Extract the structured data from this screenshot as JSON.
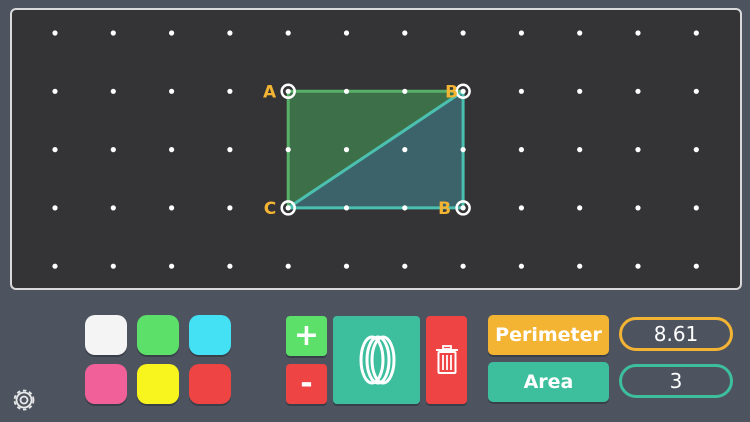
{
  "board": {
    "grid": {
      "cols": 12,
      "rows": 5
    },
    "vertices": [
      {
        "id": "A-top",
        "label": "A",
        "col": 4,
        "row": 1,
        "label_side": "left"
      },
      {
        "id": "B-top",
        "label": "B",
        "col": 7,
        "row": 1,
        "label_side": "left-overlap"
      },
      {
        "id": "C",
        "label": "C",
        "col": 4,
        "row": 3,
        "label_side": "left"
      },
      {
        "id": "B-bottom",
        "label": "B",
        "col": 7,
        "row": 3,
        "label_side": "left"
      }
    ],
    "shapes": [
      {
        "name": "green-triangle",
        "fill": "#3f7a4c",
        "stroke": "#58b068",
        "points": [
          [
            4,
            1
          ],
          [
            7,
            1
          ],
          [
            4,
            3
          ]
        ]
      },
      {
        "name": "teal-triangle",
        "fill": "#3d6c72",
        "stroke": "#4bc0b0",
        "points": [
          [
            7,
            1
          ],
          [
            7,
            3
          ],
          [
            4,
            3
          ]
        ]
      }
    ],
    "label_color": "#f4b433"
  },
  "colors": [
    {
      "name": "white",
      "hex": "#f4f4f4"
    },
    {
      "name": "green",
      "hex": "#5ce06a"
    },
    {
      "name": "cyan",
      "hex": "#44e0f4"
    },
    {
      "name": "pink",
      "hex": "#f2609a"
    },
    {
      "name": "yellow",
      "hex": "#f8f41e"
    },
    {
      "name": "red",
      "hex": "#ee4444"
    }
  ],
  "controls": {
    "plus_label": "+",
    "minus_label": "-",
    "rubber_band_icon": "rubber-band-icon",
    "delete_icon": "trash-icon"
  },
  "measures": {
    "perimeter_label": "Perimeter",
    "perimeter_value": "8.61",
    "area_label": "Area",
    "area_value": "3"
  },
  "settings_icon": "gear-icon",
  "theme": {
    "perimeter": "#f4b433",
    "area": "#3dbf9e",
    "plus": "#5ce06a",
    "minus": "#ee4444",
    "band": "#3dbf9e",
    "delete": "#ee4444"
  }
}
